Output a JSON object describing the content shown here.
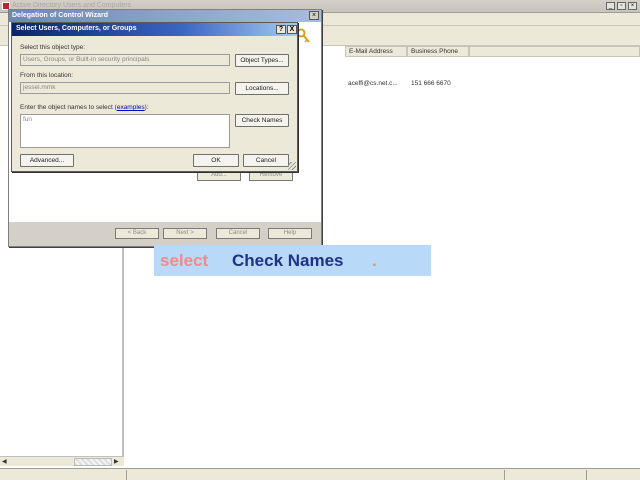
{
  "background_window": {
    "title": "Active Directory Users and Computers",
    "columns": [
      "E-Mail Address",
      "Business Phone"
    ],
    "row": {
      "email": "aceffi@cs.net.c...",
      "phone": "151 666 6670"
    }
  },
  "wizard": {
    "title": "Delegation of Control Wizard",
    "buttons": {
      "back": "< Back",
      "next": "Next >",
      "cancel": "Cancel",
      "help": "Help"
    },
    "hidden_buttons": {
      "add": "Add...",
      "remove": "Remove"
    }
  },
  "dialog": {
    "title": "Select Users, Computers, or Groups",
    "object_type_label": "Select this object type:",
    "object_type_value": "Users, Groups, or Built-in security principals",
    "object_types_button": "Object Types...",
    "location_label": "From this location:",
    "location_value": "jessel.mmk",
    "locations_button": "Locations...",
    "names_label_prefix": "Enter the object names to select (",
    "names_label_link": "examples",
    "names_label_suffix": "):",
    "names_value": "fun",
    "check_names_button": "Check Names",
    "advanced_button": "Advanced...",
    "ok_button": "OK",
    "cancel_button": "Cancel",
    "help_glyph": "?",
    "close_glyph": "X"
  },
  "caption": {
    "word1": "select",
    "word2": "Check Names",
    "dot": "."
  },
  "colors": {
    "caption_bg": "#b8d9f7",
    "caption_action": "#f28a8a",
    "caption_target": "#20318a",
    "dialog_title": "#0a246a"
  }
}
